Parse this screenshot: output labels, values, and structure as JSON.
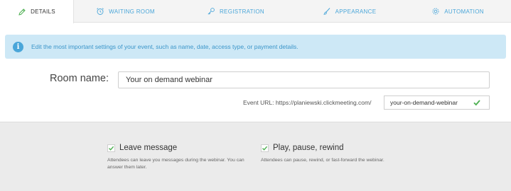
{
  "tabs": [
    {
      "label": "DETAILS",
      "icon": "pencil-icon",
      "active": true
    },
    {
      "label": "WAITING ROOM",
      "icon": "alarm-clock-icon",
      "active": false
    },
    {
      "label": "REGISTRATION",
      "icon": "key-icon",
      "active": false
    },
    {
      "label": "APPEARANCE",
      "icon": "brush-icon",
      "active": false
    },
    {
      "label": "AUTOMATION",
      "icon": "gear-icon",
      "active": false
    }
  ],
  "info": {
    "icon": "info-icon",
    "text": "Edit the most important settings of your event, such as name, date, access type, or payment details."
  },
  "room": {
    "label": "Room name:",
    "value": "Your on demand webinar"
  },
  "url": {
    "label": "Event URL: https://planiewski.clickmeeting.com/",
    "value": "your-on-demand-webinar",
    "valid_icon": "checkmark-icon"
  },
  "options": [
    {
      "title": "Leave message",
      "checked": true,
      "description": "Attendees can leave you messages during the webinar. You can answer them later."
    },
    {
      "title": "Play, pause, rewind",
      "checked": true,
      "description": "Attendees can pause, rewind, or fast-forward the webinar."
    }
  ],
  "colors": {
    "accent": "#4aa6d9",
    "info_bg": "#cde8f6",
    "check_green": "#4caf50",
    "section_gray": "#ebebeb"
  }
}
